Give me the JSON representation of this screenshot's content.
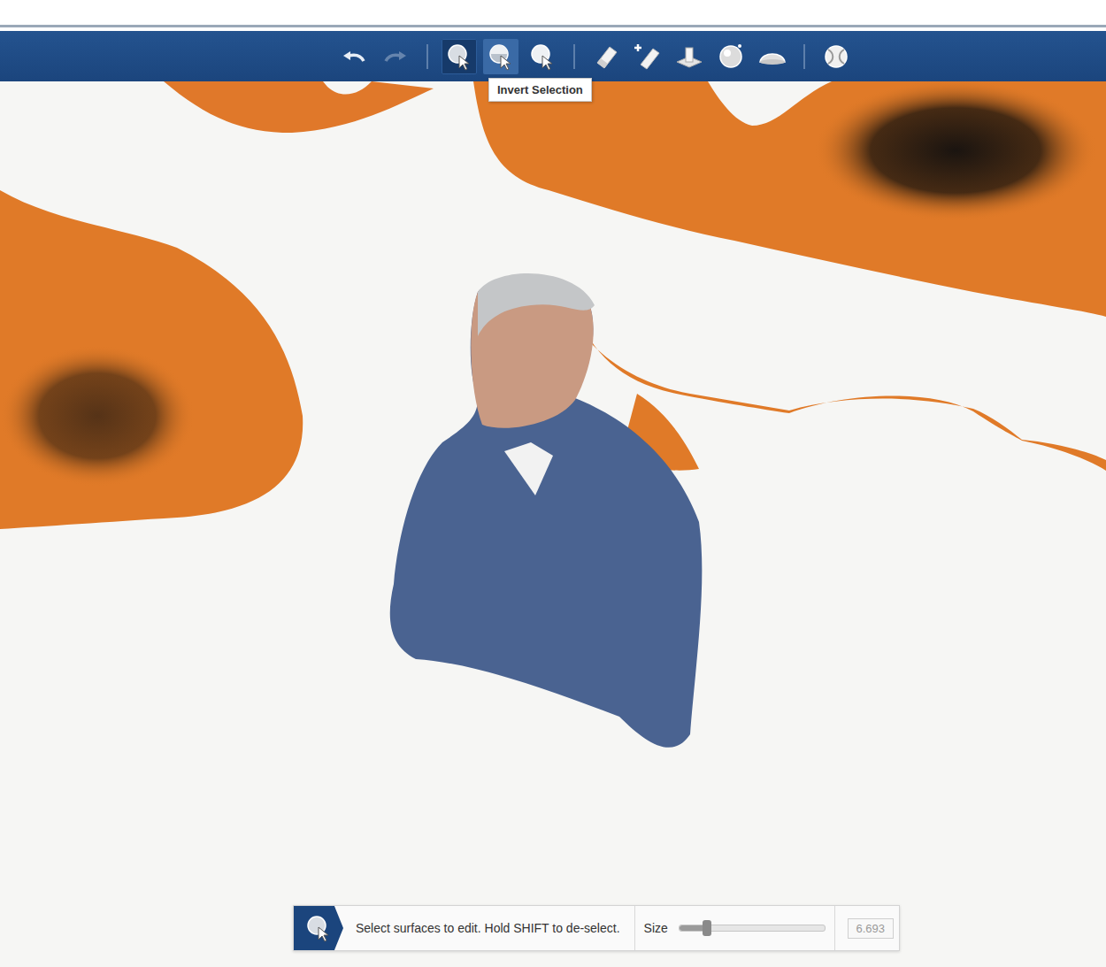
{
  "toolbar": {
    "buttons": [
      {
        "kind": "undo",
        "selected": false,
        "hovered": false,
        "disabled": false
      },
      {
        "kind": "redo",
        "selected": false,
        "hovered": false,
        "disabled": true
      },
      {
        "kind": "separator"
      },
      {
        "kind": "select",
        "selected": true,
        "hovered": false,
        "disabled": false
      },
      {
        "kind": "select-invert",
        "selected": false,
        "hovered": true,
        "disabled": false
      },
      {
        "kind": "select-clear",
        "selected": false,
        "hovered": false,
        "disabled": false
      },
      {
        "kind": "separator"
      },
      {
        "kind": "eraser",
        "selected": false,
        "hovered": false,
        "disabled": false
      },
      {
        "kind": "eraser-add",
        "selected": false,
        "hovered": false,
        "disabled": false
      },
      {
        "kind": "extrude",
        "selected": false,
        "hovered": false,
        "disabled": false
      },
      {
        "kind": "sphere",
        "selected": false,
        "hovered": false,
        "disabled": false
      },
      {
        "kind": "dome",
        "selected": false,
        "hovered": false,
        "disabled": false
      },
      {
        "kind": "separator"
      },
      {
        "kind": "ball",
        "selected": false,
        "hovered": false,
        "disabled": false
      }
    ]
  },
  "tooltip": {
    "text": "Invert Selection"
  },
  "status_bar": {
    "hint": "Select surfaces to edit. Hold SHIFT to de-select.",
    "size_label": "Size",
    "size_level": 0.19,
    "size_value": "6.693",
    "size_value_disabled": true
  }
}
